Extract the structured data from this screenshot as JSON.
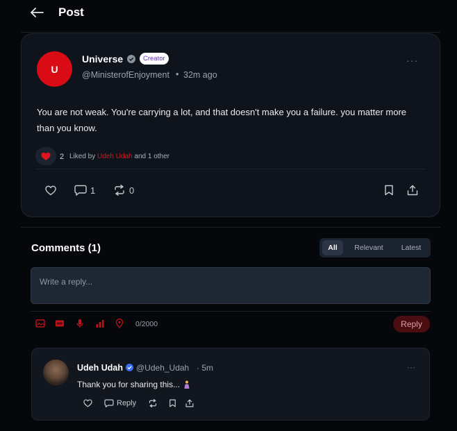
{
  "header": {
    "title": "Post",
    "back_icon": "arrow-left-icon"
  },
  "post": {
    "avatar_letter": "U",
    "author_name": "Universe",
    "badge": "Creator",
    "handle": "@MinisterofEnjoyment",
    "separator": "•",
    "time": "32m ago",
    "more": "···",
    "body": "You are not weak. You're carrying a lot, and that doesn't make you a failure. you matter more than you know.",
    "like_count": "2",
    "liked_by_prefix": "Liked by",
    "liked_by_user": "Udeh Udah",
    "liked_by_suffix": "and 1 other",
    "comment_count": "1",
    "repost_count": "0"
  },
  "comments": {
    "title": "Comments (1)",
    "tabs": [
      {
        "label": "All"
      },
      {
        "label": "Relevant"
      },
      {
        "label": "Latest"
      }
    ],
    "active_tab": "All",
    "reply_placeholder": "Write a reply...",
    "char_count": "0/2000",
    "reply_button": "Reply",
    "tools": [
      "image-icon",
      "gif-icon",
      "microphone-icon",
      "poll-icon",
      "location-icon"
    ],
    "items": [
      {
        "author_name": "Udeh Udah",
        "handle": "@Udeh_Udah",
        "separator": "·",
        "time": "5m",
        "more": "···",
        "text": "Thank you for sharing this...",
        "emoji": "praying-person-emoji",
        "reply_label": "Reply"
      }
    ]
  },
  "colors": {
    "background": "#05070b",
    "card": "#0f141c",
    "accent_red": "#d90c16",
    "verified_blue": "#3b6ff5",
    "badge_text": "#6a2fd1"
  }
}
